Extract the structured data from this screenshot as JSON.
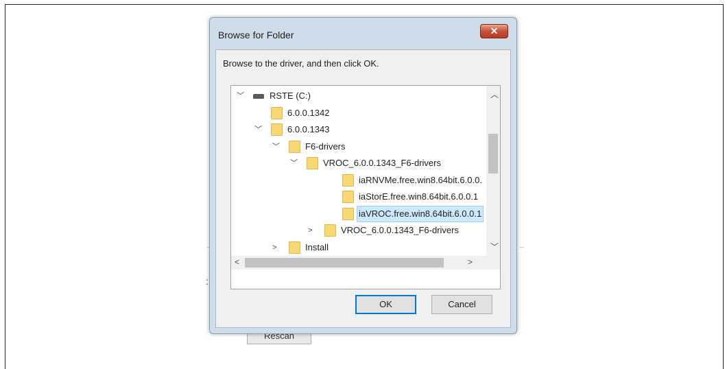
{
  "background": {
    "partial_button_label": "Rescan",
    "colon_text": ":"
  },
  "dialog": {
    "title": "Browse for Folder",
    "close_symbol": "✕",
    "instruction": "Browse to the driver, and then click OK.",
    "tree": [
      {
        "label": "RSTE (C:)",
        "icon": "drive-icon",
        "expander": "expanded",
        "selected": false
      },
      {
        "label": "6.0.0.1342",
        "icon": "folder-icon",
        "expander": "none",
        "selected": false
      },
      {
        "label": "6.0.0.1343",
        "icon": "folder-icon",
        "expander": "expanded",
        "selected": false
      },
      {
        "label": "F6-drivers",
        "icon": "folder-icon",
        "expander": "expanded",
        "selected": false
      },
      {
        "label": "VROC_6.0.0.1343_F6-drivers",
        "icon": "folder-icon",
        "expander": "expanded",
        "selected": false
      },
      {
        "label": "iaRNVMe.free.win8.64bit.6.0.0.",
        "icon": "folder-icon",
        "expander": "none",
        "selected": false
      },
      {
        "label": "iaStorE.free.win8.64bit.6.0.0.1",
        "icon": "folder-icon",
        "expander": "none",
        "selected": false
      },
      {
        "label": "iaVROC.free.win8.64bit.6.0.0.1",
        "icon": "folder-icon",
        "expander": "none",
        "selected": true
      },
      {
        "label": "VROC_6.0.0.1343_F6-drivers",
        "icon": "folder-icon",
        "expander": "collapsed",
        "selected": false
      },
      {
        "label": "Install",
        "icon": "folder-icon",
        "expander": "collapsed",
        "selected": false
      }
    ],
    "ok_label": "OK",
    "cancel_label": "Cancel"
  },
  "colors": {
    "selection": "#cde8ff",
    "folder": "#f8d775",
    "close_button": "#c7503a",
    "default_button_border": "#0078d7"
  }
}
